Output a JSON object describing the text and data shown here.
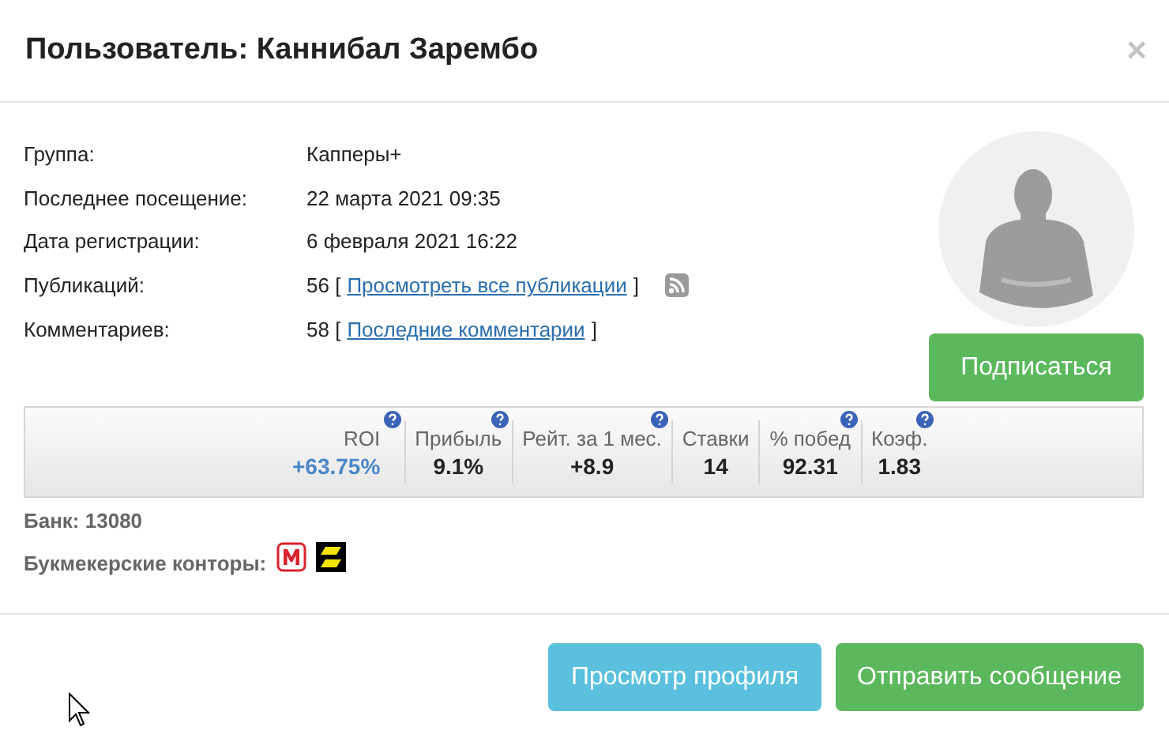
{
  "dialog": {
    "title": "Пользователь: Каннибал Зарембо",
    "close": "×"
  },
  "info": [
    {
      "label": "Группа:",
      "value": "Капперы+"
    },
    {
      "label": "Последнее посещение:",
      "value": "22 марта 2021 09:35"
    },
    {
      "label": "Дата регистрации:",
      "value": "6 февраля 2021 16:22"
    },
    {
      "label": "Публикаций:",
      "value": "56 [",
      "link": "Просмотреть все публикации",
      "after": "]",
      "rss": true
    },
    {
      "label": "Комментариев:",
      "value": "58 [",
      "link": "Последние комментарии",
      "after": "]",
      "rss": false
    }
  ],
  "subscribe_button": "Подписаться",
  "stats": [
    {
      "label": "ROI",
      "value": "+63.75%",
      "help": true,
      "highlight": true
    },
    {
      "label": "Прибыль",
      "value": "9.1%",
      "help": true,
      "highlight": false
    },
    {
      "label": "Рейт. за 1 мес.",
      "value": "+8.9",
      "help": true,
      "highlight": false
    },
    {
      "label": "Ставки",
      "value": "14",
      "help": false,
      "highlight": false
    },
    {
      "label": "% побед",
      "value": "92.31",
      "help": true,
      "highlight": false
    },
    {
      "label": "Коэф.",
      "value": "1.83",
      "help": true,
      "highlight": false
    }
  ],
  "bank": "Банк: 13080",
  "bookmakers": {
    "label": "Букмекерские конторы:",
    "logos": [
      {
        "kind": "m",
        "color": "#d9232e"
      },
      {
        "kind": "stripes",
        "color": "#f5e400"
      }
    ]
  },
  "buttons": [
    {
      "label": "Просмотр профиля",
      "kind": "info"
    },
    {
      "label": "Отправить сообщение",
      "kind": "success"
    }
  ]
}
